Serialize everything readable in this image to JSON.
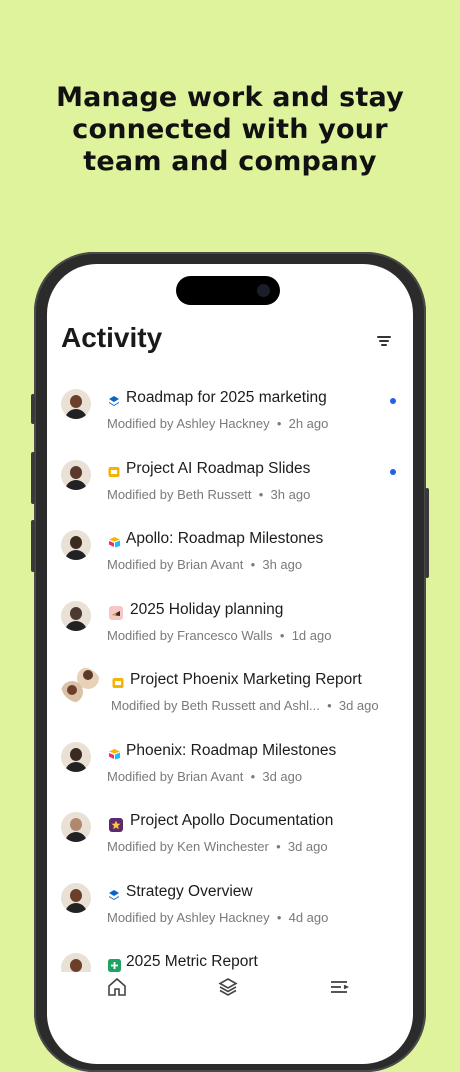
{
  "headline": {
    "line1": "Manage work and stay",
    "line2": "connected with your",
    "line3": "team and company"
  },
  "screen": {
    "title": "Activity",
    "filter_icon": "filter-icon"
  },
  "activity": [
    {
      "name": "Roadmap for 2025 marketing",
      "by": "Modified by Ashley Hackney",
      "time": "2h ago",
      "icon": "layers-icon",
      "icon_color": "#0b63c9",
      "unread": true,
      "avatar_color": "#6b3f2a"
    },
    {
      "name": "Project AI Roadmap Slides",
      "by": "Modified by Beth Russett",
      "time": "3h ago",
      "icon": "slides-icon",
      "icon_color": "#f5b400",
      "unread": true,
      "avatar_color": "#5a3a2a"
    },
    {
      "name": "Apollo: Roadmap Milestones",
      "by": "Modified by Brian Avant",
      "time": "3h ago",
      "icon": "airtable-icon",
      "icon_color": "#18bfff",
      "unread": false,
      "avatar_color": "#3b2a22"
    },
    {
      "name": "2025 Holiday planning",
      "by": "Modified by Francesco Walls",
      "time": "1d ago",
      "icon": "wedge-icon",
      "icon_color": "#f7c6c6",
      "unread": false,
      "avatar_color": "#4a3a30"
    },
    {
      "name": "Project Phoenix Marketing Report",
      "by": "Modified by Beth Russett and Ashl...",
      "time": "3d ago",
      "icon": "slides-icon",
      "icon_color": "#f5b400",
      "unread": false,
      "avatar_color": "#6b3f2a"
    },
    {
      "name": "Phoenix: Roadmap Milestones",
      "by": "Modified by Brian Avant",
      "time": "3d ago",
      "icon": "airtable-icon",
      "icon_color": "#18bfff",
      "unread": false,
      "avatar_color": "#3b2a22"
    },
    {
      "name": "Project Apollo Documentation",
      "by": "Modified by Ken Winchester",
      "time": "3d ago",
      "icon": "star-icon",
      "icon_color": "#5c2a6e",
      "unread": false,
      "avatar_color": "#b08870"
    },
    {
      "name": "Strategy Overview",
      "by": "Modified by Ashley Hackney",
      "time": "4d ago",
      "icon": "layers-icon",
      "icon_color": "#0b63c9",
      "unread": false,
      "avatar_color": "#6b3f2a"
    },
    {
      "name": "2025 Metric Report",
      "by": "",
      "time": "",
      "icon": "sheets-icon",
      "icon_color": "#1ea362",
      "unread": false,
      "avatar_color": "#6b3f2a"
    }
  ],
  "tabs": [
    {
      "icon": "home-icon"
    },
    {
      "icon": "layers-icon"
    },
    {
      "icon": "activity-list-icon"
    }
  ],
  "colors": {
    "background": "#dff39d",
    "unread_dot": "#2360e8"
  }
}
